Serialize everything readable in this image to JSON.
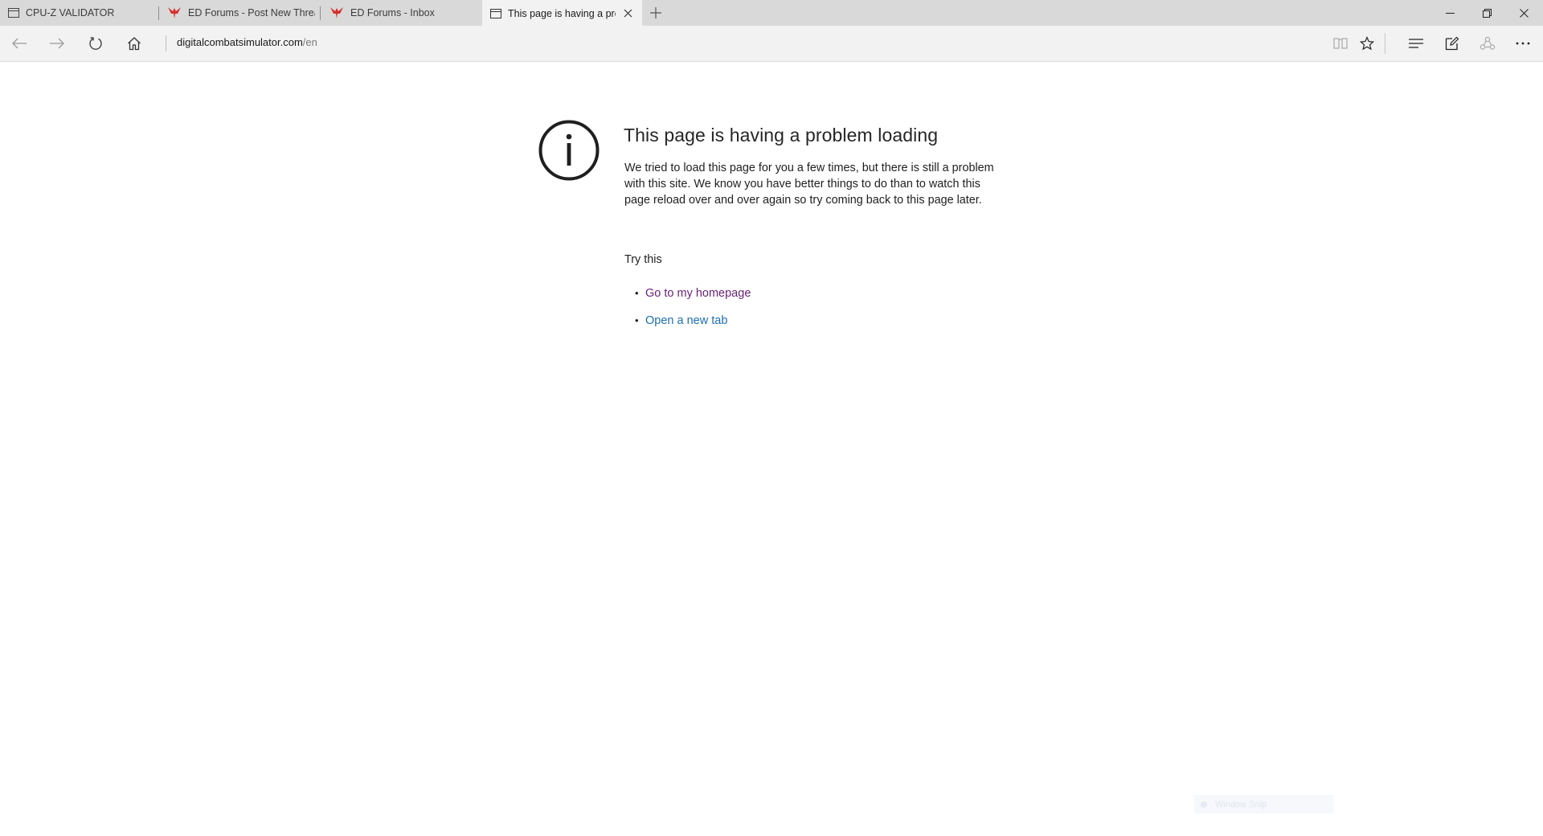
{
  "tabs": [
    {
      "title": "CPU-Z VALIDATOR",
      "icon": "page-icon",
      "active": false
    },
    {
      "title": "ED Forums - Post New Threa",
      "icon": "eagle-logo-icon",
      "active": false
    },
    {
      "title": "ED Forums - Inbox",
      "icon": "eagle-logo-icon",
      "active": false
    },
    {
      "title": "This page is having a pro",
      "icon": "page-icon",
      "active": true
    }
  ],
  "address": {
    "host": "digitalcombatsimulator.com",
    "path": "/en"
  },
  "error": {
    "title": "This page is having a problem loading",
    "body": "We tried to load this page for you a few times, but there is still a problem with this site. We know you have better things to do than to watch this page reload over and over again so try coming back to this page later.",
    "try_heading": "Try this",
    "links": [
      {
        "label": "Go to my homepage",
        "color": "#6a2378"
      },
      {
        "label": "Open a new tab",
        "color": "#1c6fb4"
      }
    ]
  },
  "snip": {
    "label": "Window Snip"
  },
  "colors": {
    "tabbar_bg": "#d9d9d9",
    "toolbar_bg": "#f2f2f2",
    "eagle_logo": "#d6302a"
  }
}
